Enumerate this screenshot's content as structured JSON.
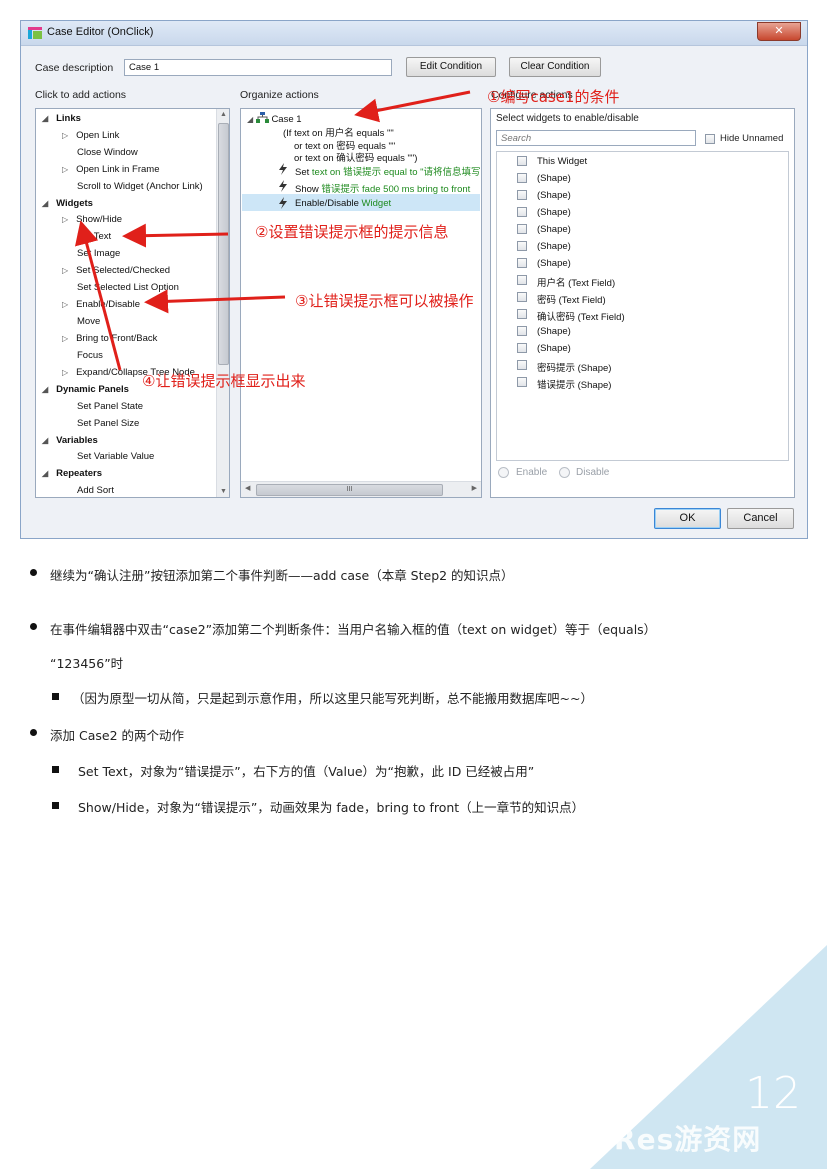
{
  "dialog": {
    "title": "Case Editor (OnClick)",
    "close_label": "✕",
    "case_description_label": "Case description",
    "case_description_value": "Case 1",
    "edit_condition_label": "Edit Condition",
    "clear_condition_label": "Clear Condition",
    "add_actions_header": "Click to add actions",
    "organize_header": "Organize actions",
    "configure_header": "Configure actions",
    "actions_tree": {
      "links": "Links",
      "open_link": "Open Link",
      "close_window": "Close Window",
      "open_link_in_frame": "Open Link in Frame",
      "scroll_to_widget": "Scroll to Widget (Anchor Link)",
      "widgets": "Widgets",
      "show_hide": "Show/Hide",
      "set_text": "Set Text",
      "set_image": "Set Image",
      "set_selected": "Set Selected/Checked",
      "set_selected_list": "Set Selected List Option",
      "enable_disable": "Enable/Disable",
      "move": "Move",
      "bring_front": "Bring to Front/Back",
      "focus": "Focus",
      "expand_collapse": "Expand/Collapse Tree Node",
      "dynamic_panels": "Dynamic Panels",
      "set_panel_state": "Set Panel State",
      "set_panel_size": "Set Panel Size",
      "variables": "Variables",
      "set_variable_value": "Set Variable Value",
      "repeaters": "Repeaters",
      "add_sort": "Add Sort"
    },
    "organize": {
      "case_label": "Case 1",
      "cond_1": "(If text on 用户名 equals \"\"",
      "cond_2": "or text on 密码 equals \"\"",
      "cond_3": "or text on 确认密码 equals \"\")",
      "a1_verb": "Set",
      "a1_rest": "text on 错误提示 equal to \"请将信息填写",
      "a2_verb": "Show",
      "a2_rest": "错误提示 fade 500 ms bring to front",
      "a3_verb": "Enable/Disable",
      "a3_rest": "Widget",
      "hscroll_label": "III"
    },
    "configure": {
      "select_label": "Select widgets to enable/disable",
      "search_placeholder": "Search",
      "hide_unnamed": "Hide Unnamed",
      "widgets": [
        "This Widget",
        "(Shape)",
        "(Shape)",
        "(Shape)",
        "(Shape)",
        "(Shape)",
        "(Shape)",
        "用户名 (Text Field)",
        "密码 (Text Field)",
        "确认密码 (Text Field)",
        "(Shape)",
        "(Shape)",
        "密码提示 (Shape)",
        "错误提示 (Shape)"
      ],
      "enable_label": "Enable",
      "disable_label": "Disable"
    },
    "ok_label": "OK",
    "cancel_label": "Cancel"
  },
  "annotations": {
    "a1": "①编写case1的条件",
    "a2": "②设置错误提示框的提示信息",
    "a3": "③让错误提示框可以被操作",
    "a4": "④让错误提示框显示出来"
  },
  "body": {
    "b1": "继续为“确认注册”按钮添加第二个事件判断——add case（本章 Step2 的知识点）",
    "b2_line1": "在事件编辑器中双击“case2”添加第二个判断条件：当用户名输入框的值（text on widget）等于（equals）",
    "b2_line2": "“123456”时",
    "b2_sub": "（因为原型一切从简，只是起到示意作用，所以这里只能写死判断，总不能搬用数据库吧~~）",
    "b3": "添加 Case2 的两个动作",
    "b3_sub1": "Set Text，对象为“错误提示”，右下方的值（Value）为“抱歉，此 ID 已经被占用”",
    "b3_sub2": "Show/Hide，对象为“错误提示”，动画效果为 fade，bring to front（上一章节的知识点）"
  },
  "page_number": "12",
  "watermark": "GameRes游资网",
  "colors": {
    "accent_red": "#e0201a",
    "corner_blue": "#cfe6f2",
    "selected_row": "#cde6f7",
    "green_text": "#1e8a1e"
  }
}
